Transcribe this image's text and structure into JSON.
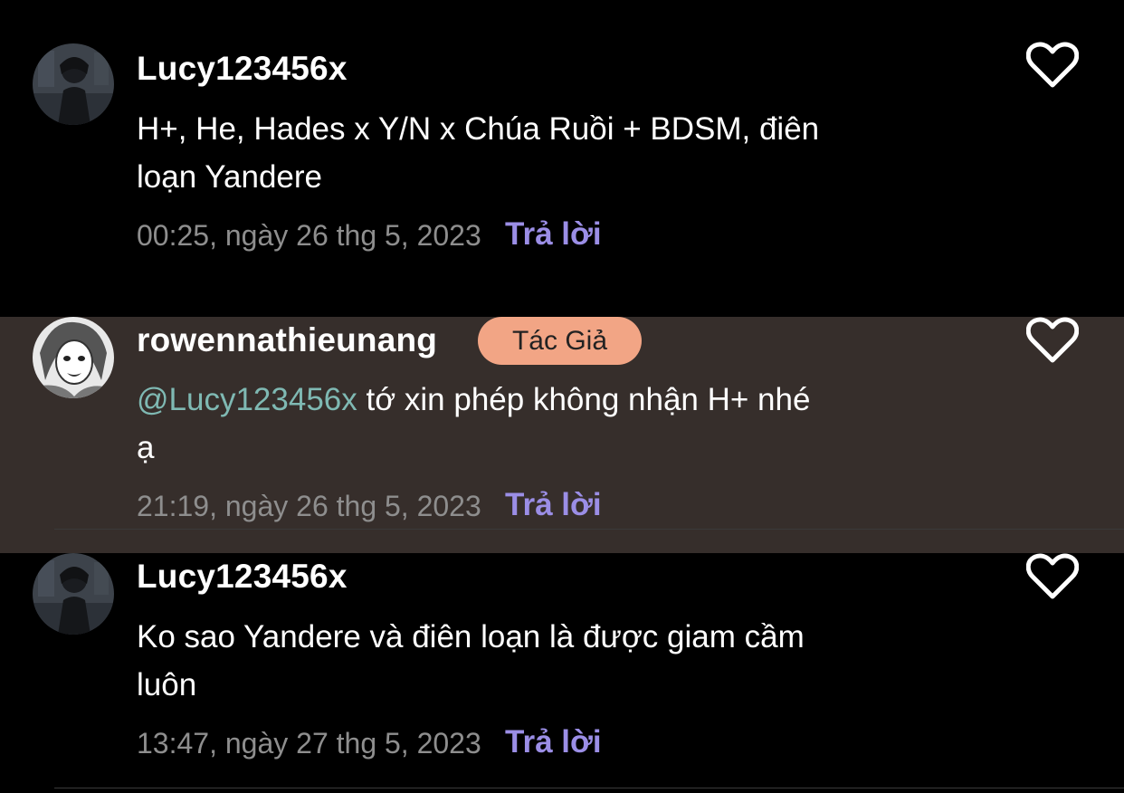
{
  "comments": [
    {
      "username": "Lucy123456x",
      "text": "H+, He, Hades x Y/N x Chúa Ruồi + BDSM, điên loạn  Yandere",
      "timestamp": "00:25, ngày 26 thg 5, 2023",
      "reply_label": "Trả lời"
    },
    {
      "username": "rowennathieunang",
      "badge": "Tác Giả",
      "mention": "@Lucy123456x",
      "text": " tớ xin phép không nhận H+ nhé ạ",
      "timestamp": "21:19, ngày 26 thg 5, 2023",
      "reply_label": "Trả lời"
    },
    {
      "username": "Lucy123456x",
      "text": "Ko sao Yandere và điên loạn là được giam cầm luôn",
      "timestamp": "13:47, ngày 27 thg 5, 2023",
      "reply_label": "Trả lời"
    }
  ],
  "icons": {
    "like": "heart-outline-icon",
    "avatar_1": "dark-character-avatar",
    "avatar_2": "manga-character-avatar"
  },
  "colors": {
    "background": "#000000",
    "highlight_background": "#362e2b",
    "reply_accent": "#9b8ee6",
    "mention": "#7fb9b3",
    "author_badge": "#f2a585",
    "timestamp": "#8e8e8e"
  }
}
